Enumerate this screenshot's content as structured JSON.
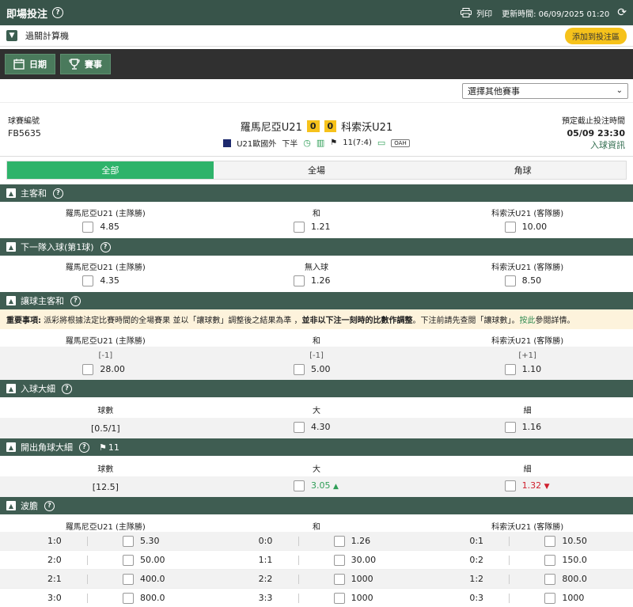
{
  "header": {
    "title": "即場投注",
    "print_label": "列印",
    "updated": "更新時間: 06/09/2025 01:20"
  },
  "calc": {
    "label": "過關計算機",
    "add_button": "添加到投注區"
  },
  "nav": {
    "date_label": "日期",
    "match_label": "賽事"
  },
  "select": {
    "label": "選擇其他賽事"
  },
  "match": {
    "code_label": "球賽編號",
    "code": "FB5635",
    "home": "羅馬尼亞U21",
    "away": "科索沃U21",
    "home_score": "0",
    "away_score": "0",
    "league": "U21歐國外",
    "period": "下半",
    "corners": "11(7:4)",
    "oah": "OAH",
    "deadline_label": "預定截止投注時間",
    "deadline": "05/09 23:30",
    "goal_info": "入球資訊"
  },
  "tabs": [
    "全部",
    "全場",
    "角球"
  ],
  "sections": {
    "hda": {
      "title": "主客和",
      "labels": [
        "羅馬尼亞U21 (主隊勝)",
        "和",
        "科索沃U21 (客隊勝)"
      ],
      "odds": [
        "4.85",
        "1.21",
        "10.00"
      ]
    },
    "ngs": {
      "title": "下一隊入球(第1球)",
      "labels": [
        "羅馬尼亞U21 (主隊勝)",
        "無入球",
        "科索沃U21 (客隊勝)"
      ],
      "odds": [
        "4.35",
        "1.26",
        "8.50"
      ]
    },
    "hhad": {
      "title": "讓球主客和",
      "notice_bold": "重要事項:",
      "notice_a": " 派彩將根據法定比賽時間的全場賽果 並以「讓球數」調整後之結果為準 ，",
      "notice_b": "並非以下注一刻時的比數作調整",
      "notice_c": "。下注前請先查閱「讓球數」。",
      "notice_link": "按此",
      "notice_d": "參閱詳情。",
      "labels": [
        "羅馬尼亞U21 (主隊勝)",
        "和",
        "科索沃U21 (客隊勝)"
      ],
      "handicaps": [
        "[-1]",
        "[-1]",
        "[+1]"
      ],
      "odds": [
        "28.00",
        "5.00",
        "1.10"
      ]
    },
    "hilo": {
      "title": "入球大細",
      "labels": [
        "球數",
        "大",
        "細"
      ],
      "line": "[0.5/1]",
      "odds": [
        "4.30",
        "1.16"
      ]
    },
    "chl": {
      "title": "開出角球大細",
      "corner_count": "11",
      "labels": [
        "球數",
        "大",
        "細"
      ],
      "line": "[12.5]",
      "odds": [
        "3.05",
        "1.32"
      ]
    },
    "crs": {
      "title": "波膽",
      "labels": [
        "羅馬尼亞U21 (主隊勝)",
        "和",
        "科索沃U21 (客隊勝)"
      ],
      "rows": [
        [
          {
            "s": "1:0",
            "o": "5.30"
          },
          {
            "s": "0:0",
            "o": "1.26"
          },
          {
            "s": "0:1",
            "o": "10.50"
          }
        ],
        [
          {
            "s": "2:0",
            "o": "50.00"
          },
          {
            "s": "1:1",
            "o": "30.00"
          },
          {
            "s": "0:2",
            "o": "150.0"
          }
        ],
        [
          {
            "s": "2:1",
            "o": "400.0"
          },
          {
            "s": "2:2",
            "o": "1000"
          },
          {
            "s": "1:2",
            "o": "800.0"
          }
        ],
        [
          {
            "s": "3:0",
            "o": "800.0"
          },
          {
            "s": "3:3",
            "o": "1000"
          },
          {
            "s": "0:3",
            "o": "1000"
          }
        ]
      ]
    }
  },
  "colors": {
    "header": "#38544a",
    "section": "#3f5d52",
    "tab_active": "#2eb36a",
    "score_bg": "#f6c21b",
    "up": "#2f9e57",
    "down": "#d0202e"
  }
}
